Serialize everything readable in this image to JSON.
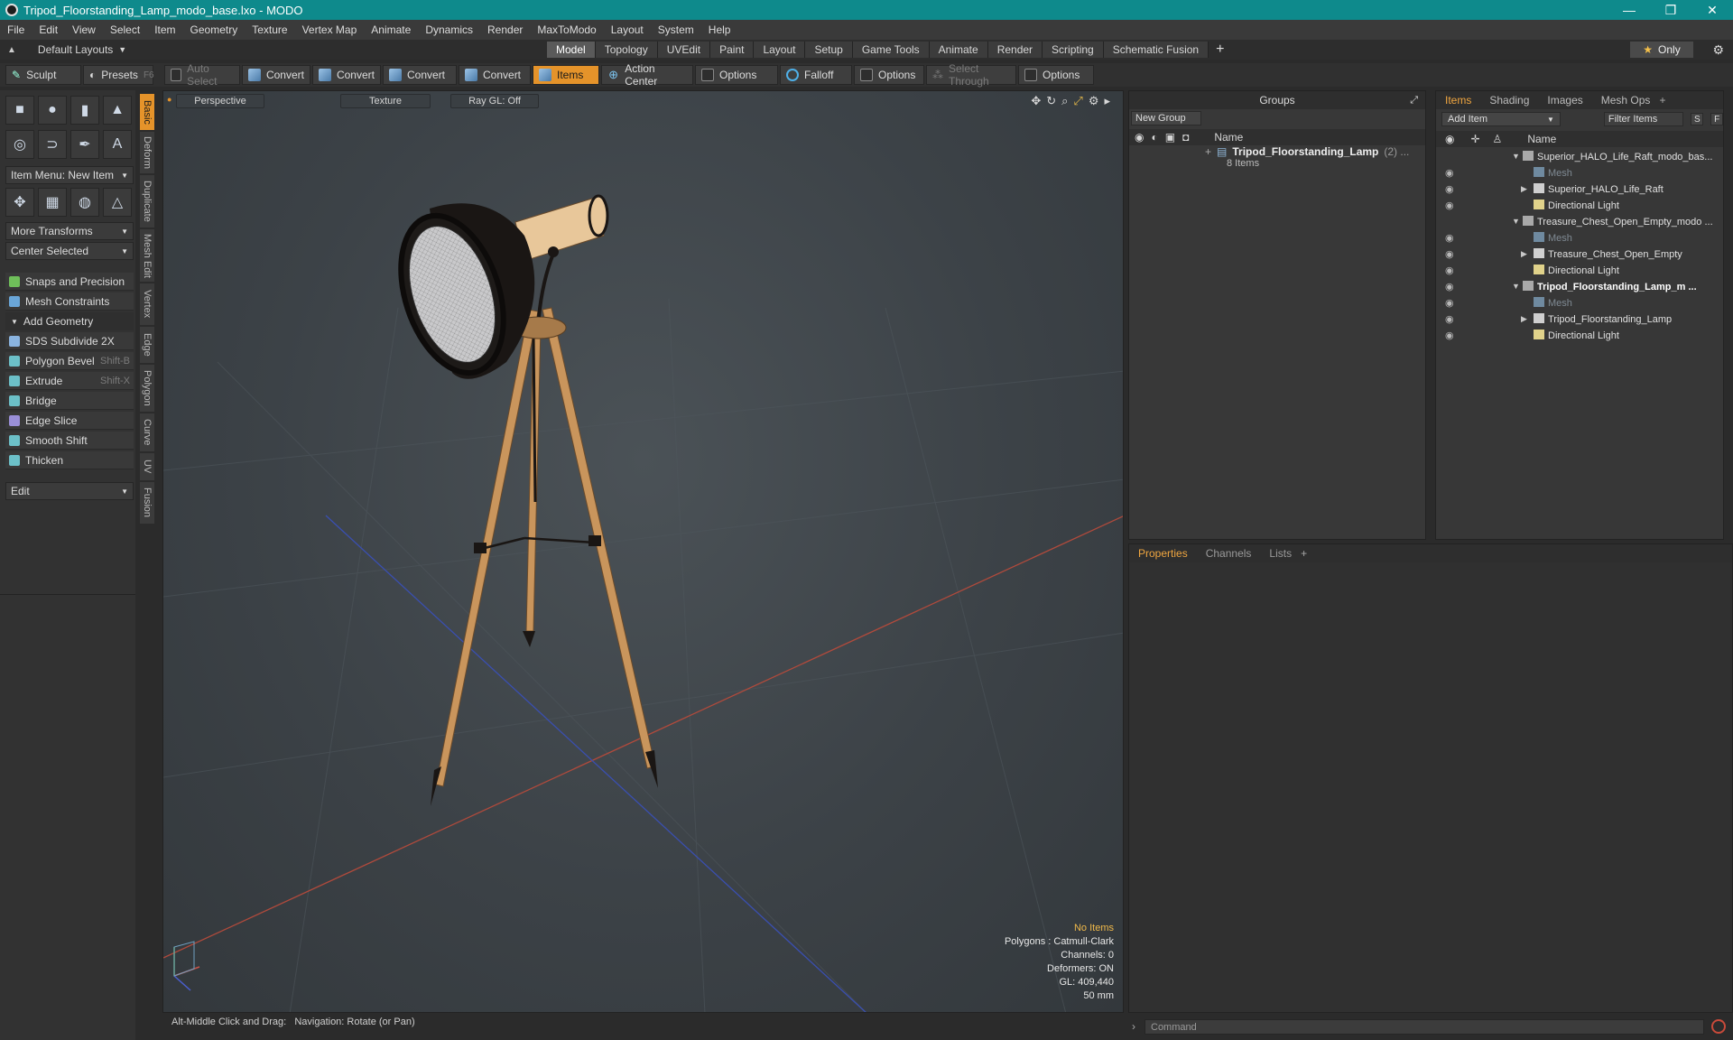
{
  "window": {
    "title": "Tripod_Floorstanding_Lamp_modo_base.lxo - MODO",
    "controls": [
      "—",
      "❐",
      "✕"
    ]
  },
  "menu": [
    "File",
    "Edit",
    "View",
    "Select",
    "Item",
    "Geometry",
    "Texture",
    "Vertex Map",
    "Animate",
    "Dynamics",
    "Render",
    "MaxToModo",
    "Layout",
    "System",
    "Help"
  ],
  "layouts": {
    "selector": "Default Layouts",
    "tabs": [
      "Model",
      "Topology",
      "UVEdit",
      "Paint",
      "Layout",
      "Setup",
      "Game Tools",
      "Animate",
      "Render",
      "Scripting",
      "Schematic Fusion"
    ],
    "active_tab": "Model",
    "only_label": "Only"
  },
  "toolbar": {
    "sculpt": "Sculpt",
    "presets": "Presets",
    "presets_key": "F6",
    "auto_select": "Auto Select",
    "convert1": "Convert",
    "convert2": "Convert",
    "convert3": "Convert",
    "convert4": "Convert",
    "items": "Items",
    "action_center": "Action Center",
    "options1": "Options",
    "falloff": "Falloff",
    "options2": "Options",
    "select_through": "Select Through",
    "options3": "Options"
  },
  "left_panel": {
    "item_menu": "Item Menu: New Item",
    "more_transforms": "More Transforms",
    "center_selected": "Center Selected",
    "snaps": "Snaps and Precision",
    "mesh_constraints": "Mesh Constraints",
    "add_geometry": "Add Geometry",
    "tools": [
      {
        "label": "SDS Subdivide 2X",
        "shortcut": ""
      },
      {
        "label": "Polygon Bevel",
        "shortcut": "Shift-B"
      },
      {
        "label": "Extrude",
        "shortcut": "Shift-X"
      },
      {
        "label": "Bridge",
        "shortcut": ""
      },
      {
        "label": "Edge Slice",
        "shortcut": ""
      },
      {
        "label": "Smooth Shift",
        "shortcut": ""
      },
      {
        "label": "Thicken",
        "shortcut": ""
      }
    ],
    "edit": "Edit",
    "vertical_tabs": [
      "Basic",
      "Deform",
      "Duplicate",
      "Mesh Edit",
      "Vertex",
      "Edge",
      "Polygon",
      "Curve",
      "UV",
      "Fusion"
    ]
  },
  "viewport": {
    "view": "Perspective",
    "shading": "Texture",
    "raygl": "Ray GL: Off",
    "info": {
      "selection": "No Items",
      "polygons": "Polygons : Catmull-Clark",
      "channels": "Channels: 0",
      "deformers": "Deformers: ON",
      "gl": "GL: 409,440",
      "focal": "50 mm"
    }
  },
  "status": {
    "hint": "Alt-Middle Click and Drag:",
    "action": "Navigation: Rotate (or Pan)"
  },
  "groups_panel": {
    "title": "Groups",
    "new_group": "New Group",
    "col_name": "Name",
    "group_name": "Tripod_Floorstanding_Lamp",
    "group_count": "(2) ...",
    "group_sub": "8 Items"
  },
  "items_panel": {
    "tabs": [
      "Items",
      "Shading",
      "Images",
      "Mesh Ops"
    ],
    "active_tab": "Items",
    "add_item": "Add Item",
    "filter_placeholder": "Filter Items",
    "btn_s": "S",
    "btn_f": "F",
    "col_name": "Name",
    "rows": [
      {
        "label": "Superior_HALO_Life_Raft_modo_bas...",
        "kind": "scene",
        "level": 0,
        "expand": "▼",
        "eye": "",
        "style": ""
      },
      {
        "label": "Mesh",
        "kind": "mesh",
        "level": 1,
        "expand": "",
        "eye": "◉",
        "style": "dim"
      },
      {
        "label": "Superior_HALO_Life_Raft",
        "kind": "locator",
        "level": 1,
        "expand": "▶",
        "eye": "◉",
        "style": ""
      },
      {
        "label": "Directional Light",
        "kind": "light",
        "level": 1,
        "expand": "",
        "eye": "◉",
        "style": ""
      },
      {
        "label": "Treasure_Chest_Open_Empty_modo ...",
        "kind": "scene",
        "level": 0,
        "expand": "▼",
        "eye": "",
        "style": ""
      },
      {
        "label": "Mesh",
        "kind": "mesh",
        "level": 1,
        "expand": "",
        "eye": "◉",
        "style": "dim"
      },
      {
        "label": "Treasure_Chest_Open_Empty",
        "kind": "locator",
        "level": 1,
        "expand": "▶",
        "eye": "◉",
        "style": ""
      },
      {
        "label": "Directional Light",
        "kind": "light",
        "level": 1,
        "expand": "",
        "eye": "◉",
        "style": ""
      },
      {
        "label": "Tripod_Floorstanding_Lamp_m ...",
        "kind": "scene",
        "level": 0,
        "expand": "▼",
        "eye": "◉",
        "style": "bold"
      },
      {
        "label": "Mesh",
        "kind": "mesh",
        "level": 1,
        "expand": "",
        "eye": "◉",
        "style": "dim"
      },
      {
        "label": "Tripod_Floorstanding_Lamp",
        "kind": "locator",
        "level": 1,
        "expand": "▶",
        "eye": "◉",
        "style": ""
      },
      {
        "label": "Directional Light",
        "kind": "light",
        "level": 1,
        "expand": "",
        "eye": "◉",
        "style": ""
      }
    ]
  },
  "properties_panel": {
    "tabs": [
      "Properties",
      "Channels",
      "Lists"
    ],
    "active_tab": "Properties"
  },
  "command": {
    "placeholder": "Command"
  },
  "colors": {
    "accent": "#e5932a",
    "titlebar": "#0e8a8c",
    "wood": "#c9955c",
    "lamp_black": "#1a1614"
  }
}
